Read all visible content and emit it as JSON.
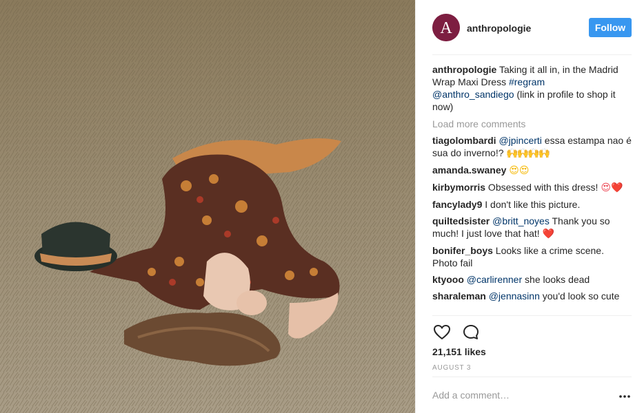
{
  "post": {
    "image_description_icon": "photo"
  },
  "header": {
    "username": "anthropologie",
    "avatar_letter": "A",
    "follow_label": "Follow"
  },
  "caption": {
    "username": "anthropologie",
    "text_1": " Taking it all in, in the Madrid Wrap Maxi Dress ",
    "hashtag": "#regram",
    "mention": "@anthro_sandiego",
    "text_2": " (link in profile to shop it now)"
  },
  "load_more_label": "Load more comments",
  "comments": [
    {
      "username": "tiagolombardi",
      "mention": "@jpincerti",
      "text": " essa estampa nao é sua do inverno!? ",
      "emoji": "🙌🙌🙌🙌"
    },
    {
      "username": "amanda.swaney",
      "mention": "",
      "text": " ",
      "emoji": "😍😍"
    },
    {
      "username": "kirbymorris",
      "mention": "",
      "text": " Obsessed with this dress! ",
      "emoji": "😍❤️"
    },
    {
      "username": "fancylady9",
      "mention": "",
      "text": " I don't like this picture.",
      "emoji": ""
    },
    {
      "username": "quiltedsister",
      "mention": "@britt_noyes",
      "text": " Thank you so much! I just love that hat! ",
      "emoji": "❤️"
    },
    {
      "username": "bonifer_boys",
      "mention": "",
      "text": " Looks like a crime scene. Photo fail",
      "emoji": ""
    },
    {
      "username": "ktyooo",
      "mention": "@carlirenner",
      "text": " she looks dead",
      "emoji": ""
    },
    {
      "username": "sharaleman",
      "mention": "@jennasinn",
      "text": " you'd look so cute",
      "emoji": ""
    }
  ],
  "likes_text": "21,151 likes",
  "date_text": "AUGUST 3",
  "add_comment_placeholder": "Add a comment…",
  "icons": {
    "like": "heart-icon",
    "comment": "comment-bubble-icon",
    "more": "more-options-icon"
  },
  "colors": {
    "follow_button": "#3897f0",
    "mention": "#003569",
    "muted": "#999999",
    "avatar_bg": "#7d1e41"
  }
}
